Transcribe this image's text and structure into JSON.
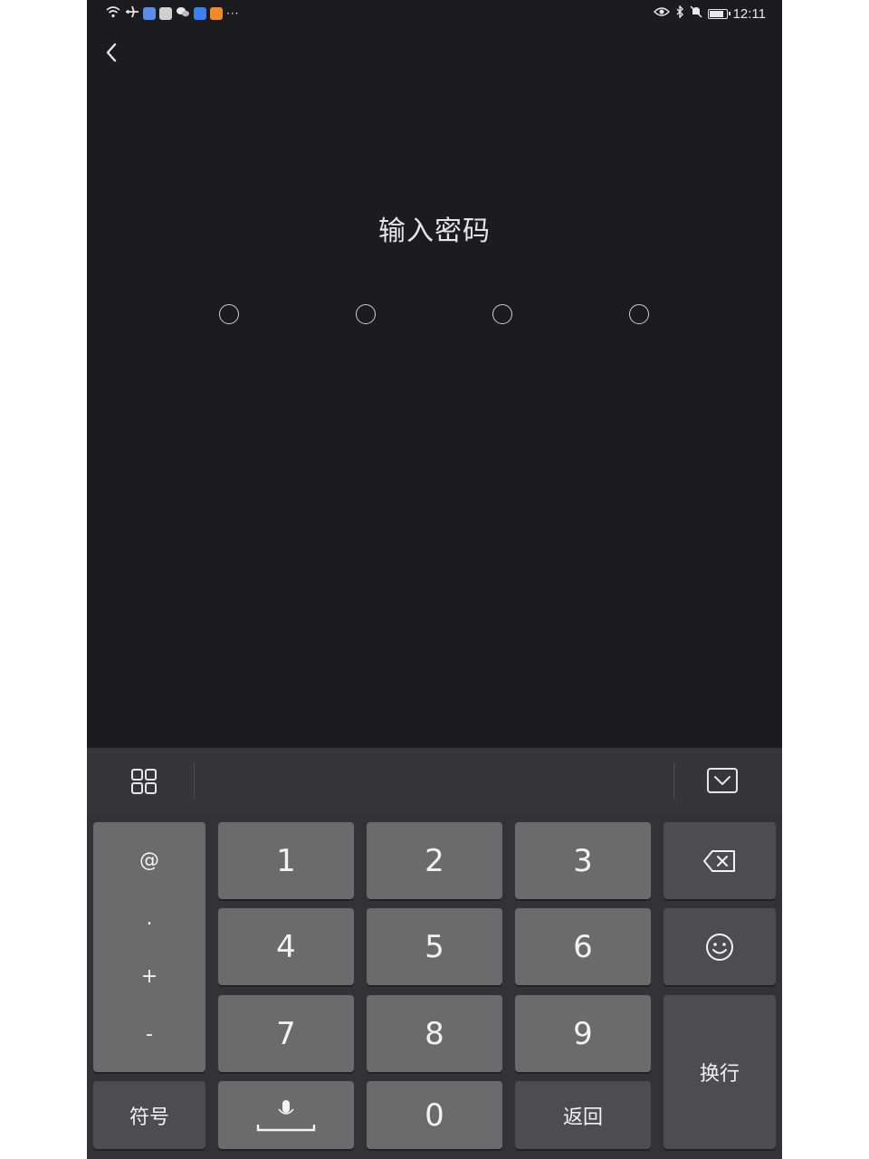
{
  "status_bar": {
    "time": "12:11",
    "more": "···",
    "left_icons": [
      "wifi-icon",
      "airplane-icon",
      "app-icon-blue",
      "mail-icon",
      "wechat-icon",
      "app-icon-blue-2",
      "app-icon-orange"
    ],
    "right_icons": [
      "eye-icon",
      "bluetooth-icon",
      "mute-icon",
      "battery-icon"
    ]
  },
  "page": {
    "title": "输入密码",
    "pin_length": 4,
    "pin_filled": 0
  },
  "keyboard": {
    "toolbar": {
      "left_icon": "grid-menu-icon",
      "right_icon": "collapse-keyboard-icon"
    },
    "side_symbols": [
      "@",
      ".",
      "+",
      "-"
    ],
    "digits": [
      "1",
      "2",
      "3",
      "4",
      "5",
      "6",
      "7",
      "8",
      "9"
    ],
    "symbol_key": "符号",
    "space_key": "space-mic-icon",
    "zero_key": "0",
    "return_key": "返回",
    "newline_key": "换行",
    "backspace_icon": "backspace-icon",
    "emoji_icon": "emoji-icon"
  },
  "colors": {
    "background": "#1c1b20",
    "keyboard_bg": "#333336",
    "key": "#6b6b6b",
    "key_dark": "#4d4d50",
    "text": "#e6e6e6"
  }
}
